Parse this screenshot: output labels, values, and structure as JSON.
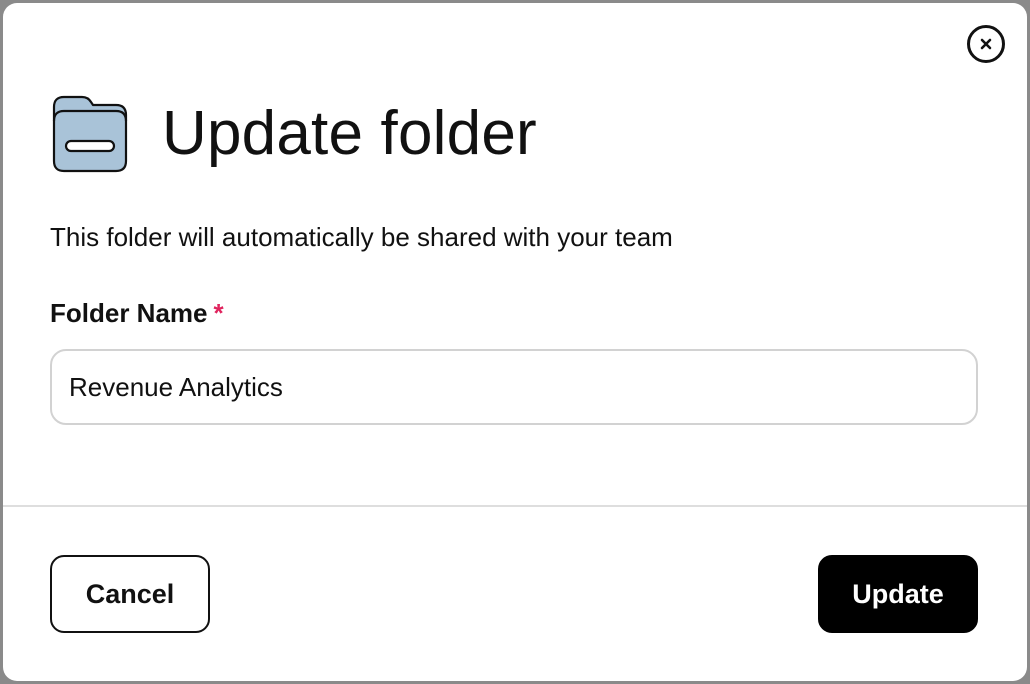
{
  "dialog": {
    "title": "Update folder",
    "description": "This folder will automatically be shared with your team",
    "close_icon": "close-icon",
    "folder_icon": "folder-icon",
    "folder_icon_fill": "#a9c3d8"
  },
  "form": {
    "folder_name_label": "Folder Name",
    "required_marker": "*",
    "folder_name_value": "Revenue Analytics",
    "required_color": "#e0245e"
  },
  "footer": {
    "cancel_label": "Cancel",
    "update_label": "Update"
  }
}
